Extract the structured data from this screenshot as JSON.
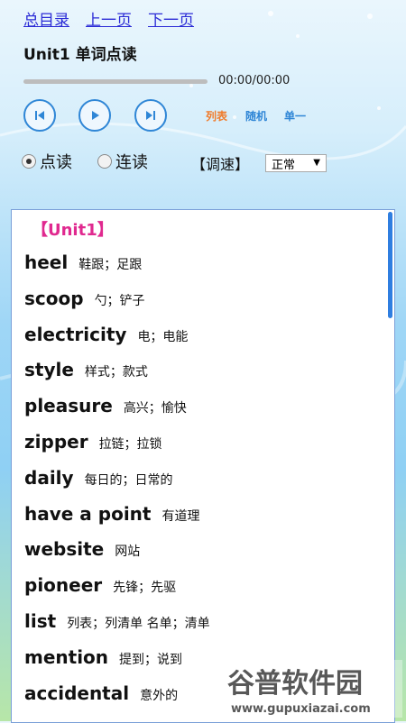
{
  "nav": {
    "home_label": "总目录",
    "prev_label": "上一页",
    "next_label": "下一页"
  },
  "player": {
    "title": "Unit1 单词点读",
    "progress": 0,
    "time": "00:00/00:00",
    "modes": {
      "list_label": "列表",
      "random_label": "随机",
      "single_label": "单一"
    }
  },
  "reading": {
    "point_label": "点读",
    "continuous_label": "连读",
    "selected": "point",
    "speed_label": "【调速】",
    "speed_value": "正常"
  },
  "unit": {
    "heading": "【Unit1】",
    "words": [
      {
        "word": "heel",
        "meaning": "鞋跟；足跟"
      },
      {
        "word": "scoop",
        "meaning": "勺；铲子"
      },
      {
        "word": "electricity",
        "meaning": "电；电能"
      },
      {
        "word": "style",
        "meaning": "样式；款式"
      },
      {
        "word": "pleasure",
        "meaning": "高兴；愉快"
      },
      {
        "word": "zipper",
        "meaning": "拉链；拉锁"
      },
      {
        "word": "daily",
        "meaning": "每日的；日常的"
      },
      {
        "word": "have a point",
        "meaning": "有道理"
      },
      {
        "word": "website",
        "meaning": "网站"
      },
      {
        "word": "pioneer",
        "meaning": "先锋；先驱"
      },
      {
        "word": "list",
        "meaning": "列表；列清单 名单；清单"
      },
      {
        "word": "mention",
        "meaning": "提到；说到"
      },
      {
        "word": "accidental",
        "meaning": "意外的"
      }
    ]
  },
  "watermark": {
    "brand": "谷普软件园",
    "url": "www.gupuxiazai.com"
  },
  "colors": {
    "link": "#2b2bd6",
    "accent_blue": "#2f86d6",
    "mode_list": "#f07b2a",
    "mode_other": "#2f86d6",
    "unit_heading": "#e0298f"
  }
}
